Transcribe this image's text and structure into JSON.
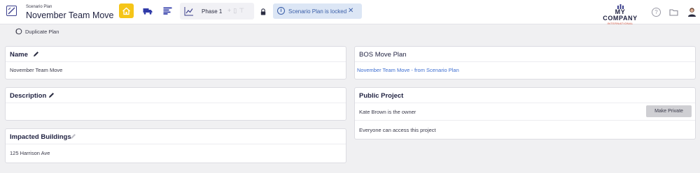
{
  "header": {
    "subtitle": "Scenario Plan",
    "title": "November Team Move",
    "phase_label": "Phase 1",
    "banner_text": "Scenario Plan is locked",
    "logo_name": "MY COMPANY",
    "logo_tagline": "INTERNATIONAL",
    "help_label": "?"
  },
  "toolbar": {
    "duplicate_label": "Duplicate Plan"
  },
  "cards": {
    "name": {
      "title": "Name",
      "value": "November Team Move"
    },
    "description": {
      "title": "Description",
      "value": ""
    },
    "impacted_buildings": {
      "title": "Impacted Buildings",
      "value": "125 Harrison Ave"
    },
    "bos_move_plan": {
      "title": "BOS Move Plan",
      "link": "November Team Move - from Scenario Plan"
    },
    "public_project": {
      "title": "Public Project",
      "owner_text": "Kate Brown is the owner",
      "button_label": "Make Private",
      "access_text": "Everyone can access this project"
    }
  },
  "colors": {
    "accent_home": "#f5c518",
    "brand_navy": "#3b3f8c",
    "info_banner_bg": "#dce6f5",
    "info_text": "#3a5ea8",
    "link": "#3f6fd1",
    "logo_tagline": "#d2462e"
  },
  "icons": [
    "plan-icon",
    "home-icon",
    "truck-icon",
    "list-icon",
    "line-chart-icon",
    "plus-icon",
    "trash-icon",
    "filter-icon",
    "lock-icon",
    "info-icon",
    "close-icon",
    "help-icon",
    "folder-icon",
    "avatar",
    "duplicate-icon",
    "pencil-icon"
  ]
}
